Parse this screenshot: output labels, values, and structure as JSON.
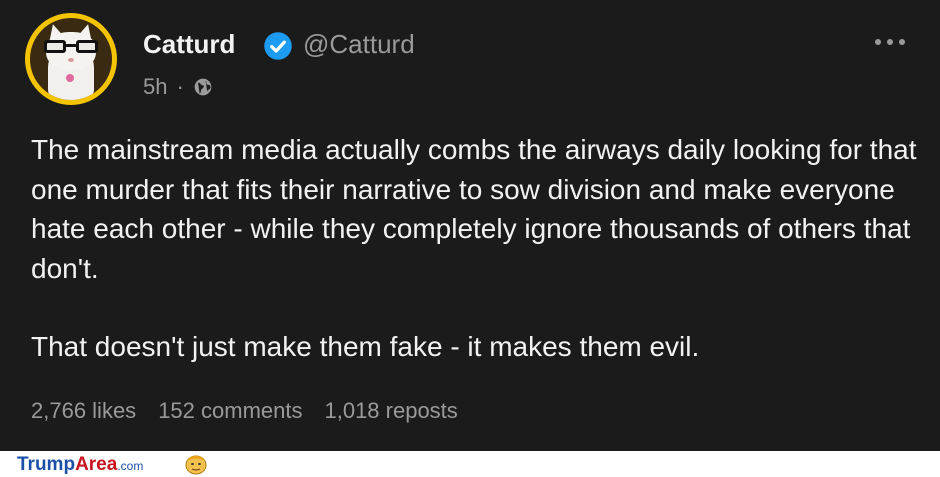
{
  "post": {
    "author_name": "Catturd",
    "author_handle": "@Catturd",
    "time": "5h",
    "separator": "·",
    "verified": true,
    "paragraphs": [
      "The mainstream media actually combs the airways daily looking for that one murder that fits their narrative to sow division and make everyone hate each other - while they completely ignore thousands of others that don't.",
      "That doesn't just make them fake - it makes them evil."
    ],
    "stats": {
      "likes": "2,766 likes",
      "comments": "152 comments",
      "reposts": "1,018 reposts"
    },
    "icons": {
      "verified": "verified-badge-icon",
      "visibility": "globe-icon",
      "menu": "more-options-icon"
    }
  },
  "watermark": {
    "part1": "Trump",
    "part2": "Area",
    "part3": ".com"
  },
  "colors": {
    "background": "#1b1b1b",
    "text_primary": "#f2f2f2",
    "text_secondary": "#9a9a9a",
    "verified_blue": "#1d9bf0",
    "avatar_ring": "#f4c400",
    "brand_blue": "#1c4fa8",
    "brand_red": "#c8141e"
  }
}
